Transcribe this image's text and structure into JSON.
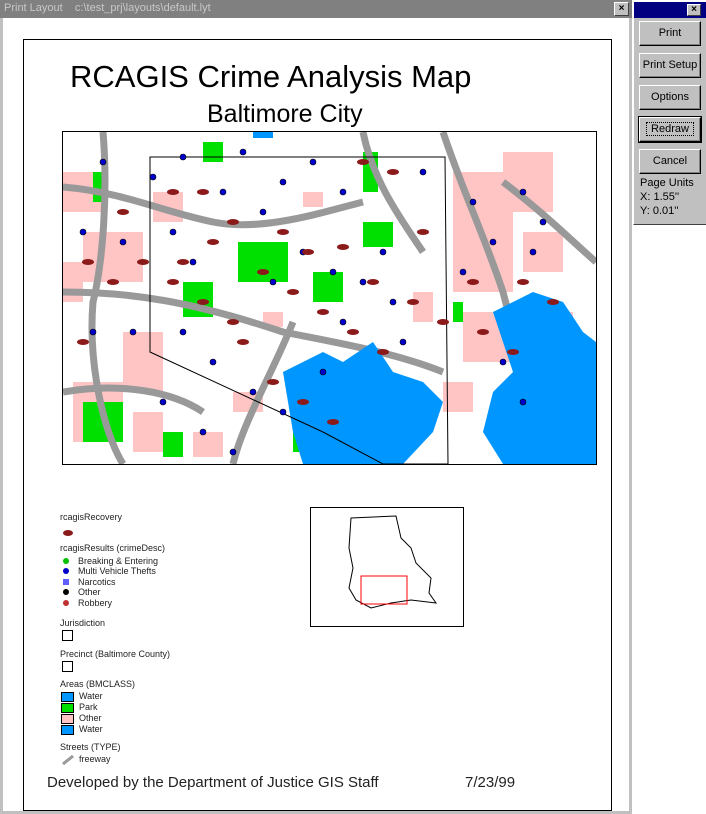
{
  "window": {
    "title": "Print Layout    c:\\test_prj\\layouts\\default.lyt",
    "close_label": "×"
  },
  "map": {
    "title": "RCAGIS Crime Analysis Map",
    "subtitle": "Baltimore City",
    "colors": {
      "park": "#00e000",
      "other": "#ffc4c4",
      "water": "#0096ff",
      "street": "#999999",
      "crime_dot": "#0000cc",
      "recovery": "#8b1a1a"
    }
  },
  "legend": {
    "recovery_label": "rcagisRecovery",
    "results_label": "rcagisResults (crimeDesc)",
    "results_items": [
      "Breaking & Entering",
      "Multi Vehicle Thefts",
      "Narcotics",
      "Other",
      "Robbery"
    ],
    "jurisdiction_label": "Jurisdiction",
    "precinct_label": "Precinct (Baltimore County)",
    "areas_label": "Areas (BMCLASS)",
    "areas_items": [
      "Water",
      "Park",
      "Other",
      "Water"
    ],
    "streets_label": "Streets (TYPE)",
    "streets_item": "freeway"
  },
  "footer": {
    "credit": "Developed by the Department of Justice GIS Staff",
    "date": "7/23/99"
  },
  "panel": {
    "close_label": "×",
    "buttons": {
      "print": "Print",
      "print_setup": "Print Setup",
      "options": "Options",
      "redraw": "Redraw",
      "cancel": "Cancel"
    },
    "units_title": "Page Units",
    "x_value": "X: 1.55''",
    "y_value": "Y: 0.01''"
  }
}
